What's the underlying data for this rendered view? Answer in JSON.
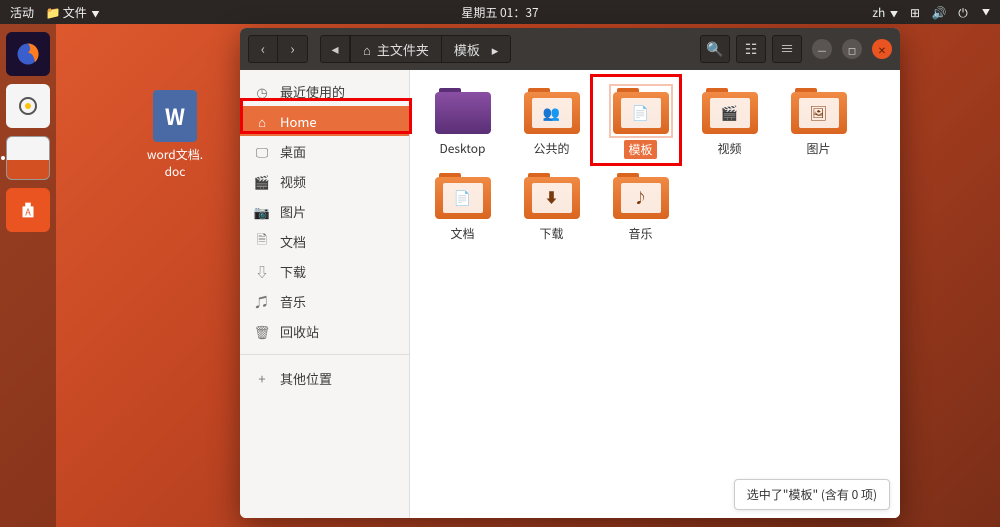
{
  "topbar": {
    "activities": "活动",
    "app_menu": "文件",
    "clock": "星期五 01：37",
    "input": "zh"
  },
  "desktop": {
    "word_icon_letter": "W",
    "word_icon_label": "word文档. doc"
  },
  "window": {
    "path_home": "主文件夹",
    "path_current": "模板",
    "status": "选中了\"模板\" (含有 0 项)"
  },
  "sidebar": {
    "items": [
      {
        "label": "最近使用的",
        "icon": "clock"
      },
      {
        "label": "Home",
        "icon": "home"
      },
      {
        "label": "桌面",
        "icon": "desktop"
      },
      {
        "label": "视频",
        "icon": "video"
      },
      {
        "label": "图片",
        "icon": "image"
      },
      {
        "label": "文档",
        "icon": "doc"
      },
      {
        "label": "下载",
        "icon": "download"
      },
      {
        "label": "音乐",
        "icon": "music"
      },
      {
        "label": "回收站",
        "icon": "trash"
      }
    ],
    "other": "其他位置"
  },
  "folders": [
    {
      "label": "Desktop",
      "kind": "desktop"
    },
    {
      "label": "公共的",
      "glyph": "👥"
    },
    {
      "label": "模板",
      "selected": true,
      "glyph": "📄"
    },
    {
      "label": "视频",
      "glyph": "🎬"
    },
    {
      "label": "图片",
      "glyph": "🖼"
    },
    {
      "label": "文档",
      "glyph": "📄"
    },
    {
      "label": "下载",
      "glyph": "⬇"
    },
    {
      "label": "音乐",
      "glyph": "♪"
    }
  ]
}
